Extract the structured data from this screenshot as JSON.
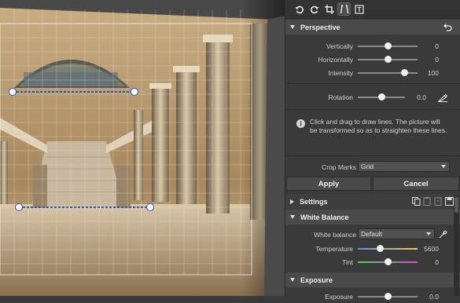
{
  "toolbar": {
    "tools": [
      {
        "name": "rotate-left-icon"
      },
      {
        "name": "rotate-right-icon"
      },
      {
        "name": "crop-icon"
      },
      {
        "name": "perspective-icon"
      },
      {
        "name": "text-icon",
        "glyph": "T"
      }
    ]
  },
  "perspective": {
    "title": "Perspective",
    "vertically_label": "Vertically",
    "vertically_value": "0",
    "vertically_fraction": 0.5,
    "horizontally_label": "Horizontally",
    "horizontally_value": "0",
    "horizontally_fraction": 0.5,
    "intensity_label": "Intensity",
    "intensity_value": "100",
    "intensity_fraction": 0.78,
    "rotation_label": "Rotation",
    "rotation_value": "0.0",
    "rotation_fraction": 0.5,
    "info_text": "Click and drag to draw lines. The picture will be transformed so as to straighten these lines.",
    "crop_marks_label": "Crop Marks",
    "crop_marks_value": "Grid",
    "apply_label": "Apply",
    "cancel_label": "Cancel"
  },
  "settings": {
    "title": "Settings"
  },
  "white_balance": {
    "title": "White Balance",
    "wb_label": "White balance",
    "wb_value": "Default",
    "temperature_label": "Temperature",
    "temperature_value": "5600",
    "temperature_fraction": 0.38,
    "tint_label": "Tint",
    "tint_value": "0",
    "tint_fraction": 0.5
  },
  "exposure": {
    "title": "Exposure",
    "exposure_label": "Exposure",
    "exposure_value": "0.0",
    "exposure_fraction": 0.5
  },
  "colors": {
    "panel_bg": "#3a3a3a",
    "header_bg": "#4a4a4a",
    "temperature_gradient_start": "#5b8ef0",
    "temperature_gradient_end": "#f0d040",
    "tint_gradient_start": "#50d060",
    "tint_gradient_end": "#d050d0"
  }
}
